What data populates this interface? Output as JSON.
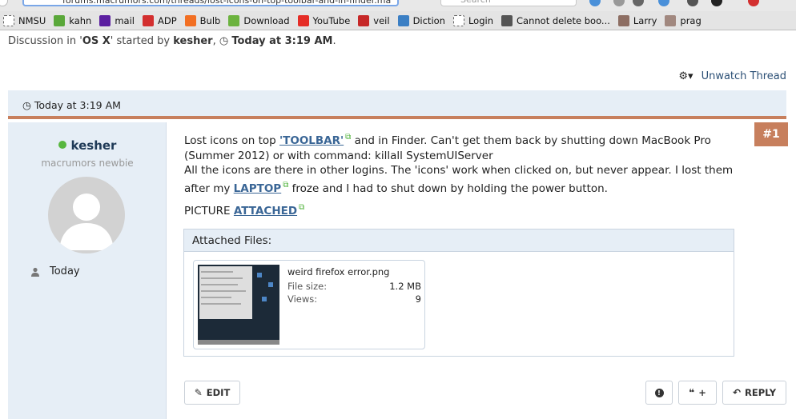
{
  "browser": {
    "url_text": "forums.macrumors.com/threads/lost-icons-on-top-toolbar-and-in-finder.ma",
    "search_placeholder": "Search"
  },
  "bookmarks": [
    {
      "label": "NMSU",
      "icon": "page-outline-icon",
      "color": "#ffffff"
    },
    {
      "label": "kahn",
      "icon": "leaf-icon",
      "color": "#5aa83a"
    },
    {
      "label": "mail",
      "icon": "yahoo-icon",
      "color": "#5b1fa0"
    },
    {
      "label": "ADP",
      "icon": "adp-icon",
      "color": "#d32f2f"
    },
    {
      "label": "Bulb",
      "icon": "soundcloud-icon",
      "color": "#f26f23"
    },
    {
      "label": "Download",
      "icon": "download-arrow-icon",
      "color": "#6cb33f"
    },
    {
      "label": "YouTube",
      "icon": "youtube-icon",
      "color": "#e52d27"
    },
    {
      "label": "veil",
      "icon": "guitar-icon",
      "color": "#c62828"
    },
    {
      "label": "Diction",
      "icon": "dictionary-icon",
      "color": "#3b7fc4"
    },
    {
      "label": "Login",
      "icon": "page-outline-icon",
      "color": "#ffffff"
    },
    {
      "label": "Cannot delete boo...",
      "icon": "apple-icon",
      "color": "#555555"
    },
    {
      "label": "Larry",
      "icon": "person-photo-icon",
      "color": "#8d6e63"
    },
    {
      "label": "prag",
      "icon": "person-photo-icon",
      "color": "#a1887f"
    }
  ],
  "discussion": {
    "prefix": "Discussion in '",
    "forum": "OS X",
    "middle": "' started by ",
    "author": "kesher",
    "separator": ", ",
    "time": "Today at 3:19 AM",
    "suffix": "."
  },
  "controls": {
    "unwatch": "Unwatch Thread"
  },
  "post": {
    "date": "Today at 3:19 AM",
    "number": "#1",
    "user": {
      "name": "kesher",
      "title": "macrumors newbie",
      "joined": "Today"
    },
    "body": {
      "p1_a": "Lost icons on top ",
      "link_toolbar": "'TOOLBAR'",
      "p1_b": " and in Finder. Can't get them back by shutting down MacBook Pro (Summer 2012) or with command: killall SystemUIServer",
      "p2_a": "All the icons are there in other logins. The 'icons' work when clicked on, but never appear. I lost them after my ",
      "link_laptop": "LAPTOP",
      "p2_b": " froze and I had to shut down by holding the power button.",
      "picture": "PICTURE ",
      "link_attached": "ATTACHED"
    },
    "attachments": {
      "title": "Attached Files:",
      "file": {
        "name": "weird firefox error.png",
        "size_label": "File size:",
        "size": "1.2 MB",
        "views_label": "Views:",
        "views": "9"
      }
    },
    "actions": {
      "edit": "EDIT",
      "reply": "REPLY",
      "quote_plus": "+"
    }
  },
  "colors": {
    "accent": "#c77f5d",
    "panel": "#e6eef6",
    "link": "#3a6696",
    "online": "#58b73f"
  }
}
